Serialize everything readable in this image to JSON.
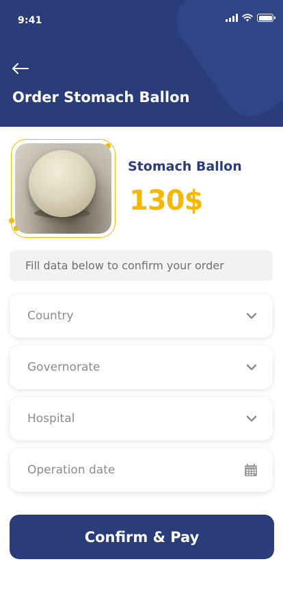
{
  "status_bar": {
    "time": "9:41"
  },
  "header": {
    "title": "Order Stomach Ballon"
  },
  "product": {
    "name": "Stomach Ballon",
    "price": "130$"
  },
  "info_text": "Fill data below to confirm your order",
  "form": {
    "country": {
      "placeholder": "Country"
    },
    "governorate": {
      "placeholder": "Governorate"
    },
    "hospital": {
      "placeholder": "Hospital"
    },
    "operation_date": {
      "placeholder": "Operation date"
    }
  },
  "confirm_label": "Confirm & Pay",
  "colors": {
    "primary": "#2a3d7a",
    "accent": "#f6b800",
    "field_text": "#8a8a8f",
    "info_bg": "#f2f2f3"
  },
  "icons": [
    "back-arrow-icon",
    "signal-icon",
    "wifi-icon",
    "battery-icon",
    "chevron-down-icon",
    "calendar-icon"
  ]
}
